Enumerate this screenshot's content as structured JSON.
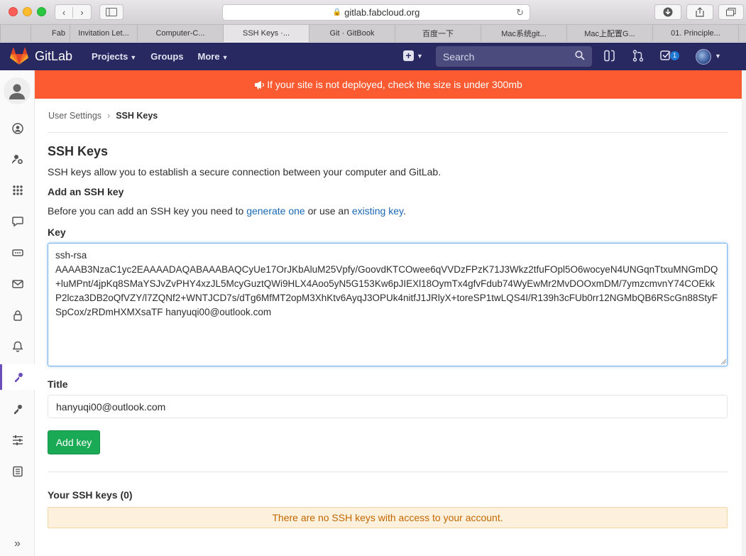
{
  "browser": {
    "url": "gitlab.fabcloud.org",
    "tabs": [
      {
        "label": "Fab",
        "active": false
      },
      {
        "label": "Invitation Let...",
        "active": false
      },
      {
        "label": "Computer-C...",
        "active": false
      },
      {
        "label": "SSH Keys ·...",
        "active": true
      },
      {
        "label": "Git · GitBook",
        "active": false
      },
      {
        "label": "百度一下",
        "active": false
      },
      {
        "label": "Mac系统git...",
        "active": false
      },
      {
        "label": "Mac上配置G...",
        "active": false
      },
      {
        "label": "01. Principle...",
        "active": false
      }
    ]
  },
  "header": {
    "logo_text": "GitLab",
    "nav": {
      "projects": "Projects",
      "groups": "Groups",
      "more": "More"
    },
    "search_placeholder": "Search",
    "todo_count": "1"
  },
  "broadcast": {
    "icon": "megaphone-icon",
    "text": "If your site is not deployed, check the size is under 300mb"
  },
  "breadcrumb": {
    "parent": "User Settings",
    "current": "SSH Keys"
  },
  "page": {
    "title": "SSH Keys",
    "intro": "SSH keys allow you to establish a secure connection between your computer and GitLab.",
    "add_heading": "Add an SSH key",
    "help_prefix": "Before you can add an SSH key you need to ",
    "help_link1": "generate one",
    "help_middle": " or use an ",
    "help_link2": "existing key",
    "help_suffix": ".",
    "key_label": "Key",
    "key_value": "ssh-rsa\nAAAAB3NzaC1yc2EAAAADAQABAAABAQCyUe17OrJKbAluM25Vpfy/GoovdKTCOwee6qVVDzFPzK71J3Wkz2tfuFOpl5O6wocyeN4UNGqnTtxuMNGmDQ+luMPnt/4jpKq8SMaYSJvZvPHY4xzJL5McyGuztQWi9HLX4Aoo5yN5G153Kw6pJIEXl18OymTx4gfvFdub74WyEwMr2MvDOOxmDM/7ymzcmvnY74COEkkP2lcza3DB2oQfVZY/l7ZQNf2+WNTJCD7s/dTg6MfMT2opM3XhKtv6AyqJ3OPUk4nitfJ1JRlyX+toreSP1twLQS4I/R139h3cFUb0rr12NGMbQB6RScGn88StyFSpCox/zRDmHXMXsaTF hanyuqi00@outlook.com\n",
    "title_label": "Title",
    "title_value": "hanyuqi00@outlook.com",
    "add_button": "Add key",
    "your_keys_heading": "Your SSH keys (0)",
    "empty_message": "There are no SSH keys with access to your account."
  },
  "colors": {
    "header_bg": "#292961",
    "broadcast_bg": "#fc5a30",
    "primary_button": "#1aaa55",
    "link": "#1b69b6",
    "warning_bg": "#fdf1dd",
    "warning_text": "#c26700",
    "active_sidebar_accent": "#6b4fbb"
  }
}
